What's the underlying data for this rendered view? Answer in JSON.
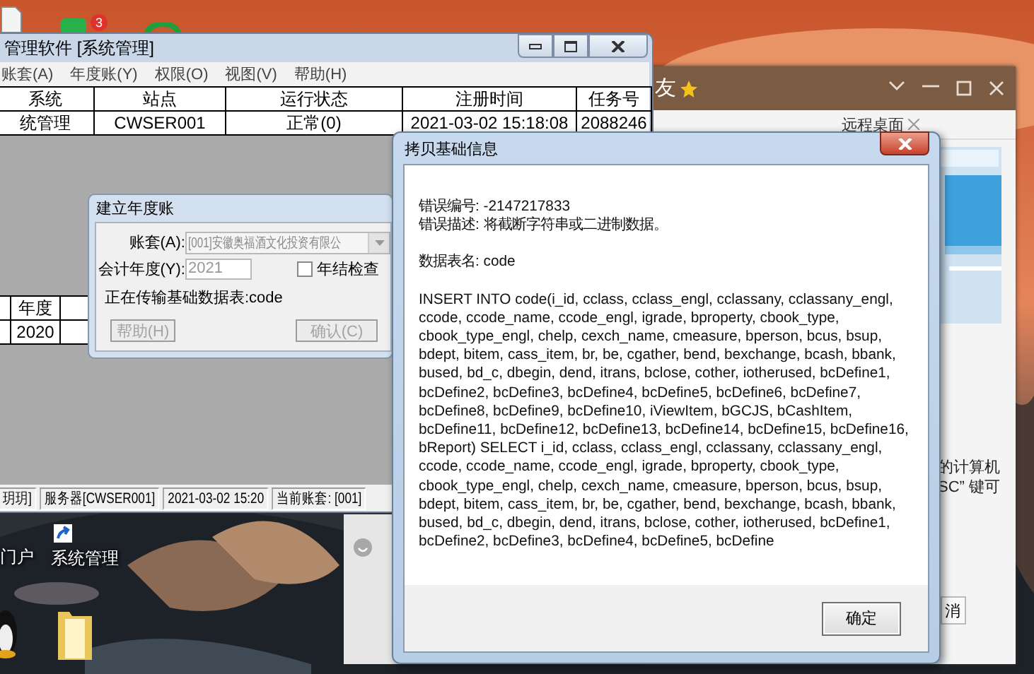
{
  "desktop": {
    "badge": "3",
    "icons": [
      {
        "label": "门户"
      },
      {
        "label": "系统管理"
      }
    ]
  },
  "main_window": {
    "title": "管理软件 [系统管理]",
    "menu": [
      "账套(A)",
      "年度账(Y)",
      "权限(O)",
      "视图(V)",
      "帮助(H)"
    ],
    "table": {
      "columns": [
        "系统",
        "站点",
        "运行状态",
        "注册时间",
        "任务号"
      ],
      "rows": [
        [
          "统管理",
          "CWSER001",
          "正常(0)",
          "2021-03-02 15:18:08",
          "2088246"
        ]
      ]
    },
    "year_table": {
      "columns": [
        "年度"
      ],
      "rows": [
        [
          "2020"
        ]
      ]
    },
    "status_bar": [
      "玥玥]",
      "服务器[CWSER001]",
      "2021-03-02 15:20",
      "当前账套: [001]"
    ]
  },
  "remote_window": {
    "title": "友",
    "tab": "远程桌面",
    "texts": [
      "的计算机",
      "SC” 键可"
    ],
    "button": "消"
  },
  "year_dialog": {
    "title": "建立年度账",
    "account_label": "账套(A):",
    "account_value": "[001]安徽奥福酒文化投资有限公",
    "year_label": "会计年度(Y):",
    "year_value": "2021",
    "check": {
      "label": "年结检查",
      "checked": false
    },
    "progress_text": "正在传输基础数据表:code",
    "buttons": [
      {
        "label": "帮助(H)",
        "disabled": true
      },
      {
        "label": "确认(C)",
        "disabled": true
      }
    ]
  },
  "error_dialog": {
    "title": "拷贝基础信息",
    "error_lines": [
      "错误编号: -2147217833",
      "错误描述: 将截断字符串或二进制数据。"
    ],
    "table_name": "数据表名: code",
    "sql_lines": [
      "INSERT INTO code(i_id, cclass, cclass_engl, cclassany, cclassany_engl,",
      "ccode, ccode_name, ccode_engl, igrade, bproperty, cbook_type,",
      "cbook_type_engl, chelp, cexch_name, cmeasure, bperson, bcus, bsup,",
      "bdept, bitem, cass_item, br, be, cgather, bend, bexchange, bcash, bbank,",
      "bused, bd_c, dbegin, dend, itrans, bclose, cother, iotherused, bcDefine1,",
      "bcDefine2, bcDefine3, bcDefine4, bcDefine5, bcDefine6, bcDefine7,",
      "bcDefine8, bcDefine9, bcDefine10, iViewItem, bGCJS, bCashItem,",
      "bcDefine11, bcDefine12, bcDefine13, bcDefine14, bcDefine15, bcDefine16,",
      "bReport) SELECT  i_id, cclass, cclass_engl, cclassany, cclassany_engl,",
      "ccode, ccode_name, ccode_engl, igrade, bproperty, cbook_type,",
      "cbook_type_engl, chelp, cexch_name, cmeasure, bperson, bcus, bsup,",
      "bdept, bitem, cass_item, br, be, cgather, bend, bexchange, bcash, bbank,",
      "bused, bd_c, dbegin, dend, itrans, bclose, cother, iotherused, bcDefine1,",
      "bcDefine2, bcDefine3, bcDefine4, bcDefine5, bcDefine"
    ],
    "ok_button": "确定"
  }
}
